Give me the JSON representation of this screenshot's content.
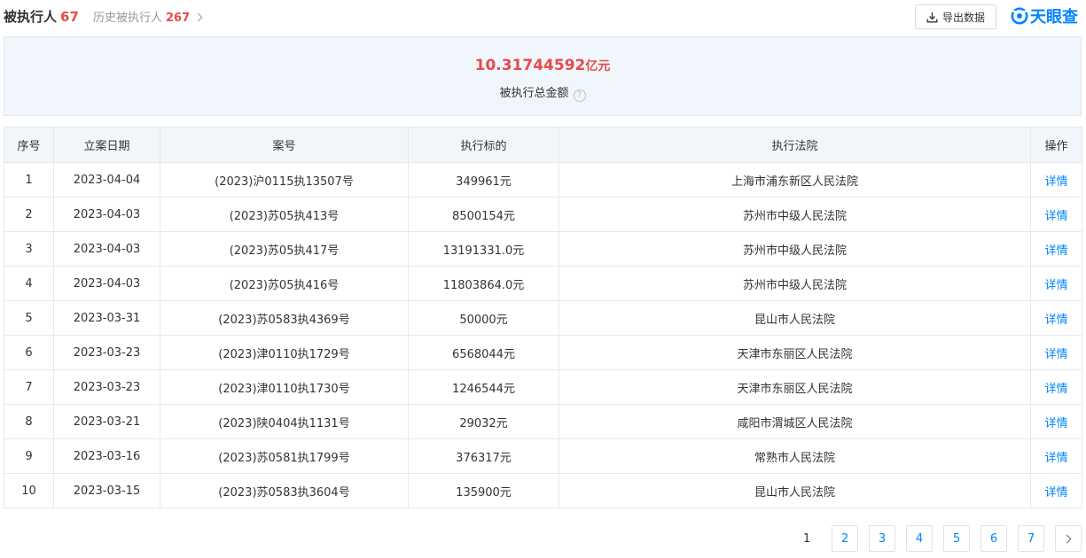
{
  "header": {
    "title": "被执行人",
    "title_count": "67",
    "history_label": "历史被执行人",
    "history_count": "267",
    "export_label": "导出数据",
    "logo_text": "天眼查"
  },
  "summary": {
    "amount": "10.31744592",
    "unit": "亿元",
    "label": "被执行总金额",
    "help": "?"
  },
  "table": {
    "columns": [
      "序号",
      "立案日期",
      "案号",
      "执行标的",
      "执行法院",
      "操作"
    ],
    "rows": [
      {
        "no": "1",
        "date": "2023-04-04",
        "case": "(2023)沪0115执13507号",
        "amount": "349961元",
        "court": "上海市浦东新区人民法院",
        "action": "详情"
      },
      {
        "no": "2",
        "date": "2023-04-03",
        "case": "(2023)苏05执413号",
        "amount": "8500154元",
        "court": "苏州市中级人民法院",
        "action": "详情"
      },
      {
        "no": "3",
        "date": "2023-04-03",
        "case": "(2023)苏05执417号",
        "amount": "13191331.0元",
        "court": "苏州市中级人民法院",
        "action": "详情"
      },
      {
        "no": "4",
        "date": "2023-04-03",
        "case": "(2023)苏05执416号",
        "amount": "11803864.0元",
        "court": "苏州市中级人民法院",
        "action": "详情"
      },
      {
        "no": "5",
        "date": "2023-03-31",
        "case": "(2023)苏0583执4369号",
        "amount": "50000元",
        "court": "昆山市人民法院",
        "action": "详情"
      },
      {
        "no": "6",
        "date": "2023-03-23",
        "case": "(2023)津0110执1729号",
        "amount": "6568044元",
        "court": "天津市东丽区人民法院",
        "action": "详情"
      },
      {
        "no": "7",
        "date": "2023-03-23",
        "case": "(2023)津0110执1730号",
        "amount": "1246544元",
        "court": "天津市东丽区人民法院",
        "action": "详情"
      },
      {
        "no": "8",
        "date": "2023-03-21",
        "case": "(2023)陕0404执1131号",
        "amount": "29032元",
        "court": "咸阳市渭城区人民法院",
        "action": "详情"
      },
      {
        "no": "9",
        "date": "2023-03-16",
        "case": "(2023)苏0581执1799号",
        "amount": "376317元",
        "court": "常熟市人民法院",
        "action": "详情"
      },
      {
        "no": "10",
        "date": "2023-03-15",
        "case": "(2023)苏0583执3604号",
        "amount": "135900元",
        "court": "昆山市人民法院",
        "action": "详情"
      }
    ]
  },
  "pagination": {
    "current": "1",
    "pages": [
      "2",
      "3",
      "4",
      "5",
      "6",
      "7"
    ],
    "next_icon": "chevron-right-icon"
  },
  "colors": {
    "accent": "#0084ff",
    "highlight": "#e84a4a",
    "summary_bg": "#f0f6fc",
    "header_bg": "#f2f6fb"
  }
}
